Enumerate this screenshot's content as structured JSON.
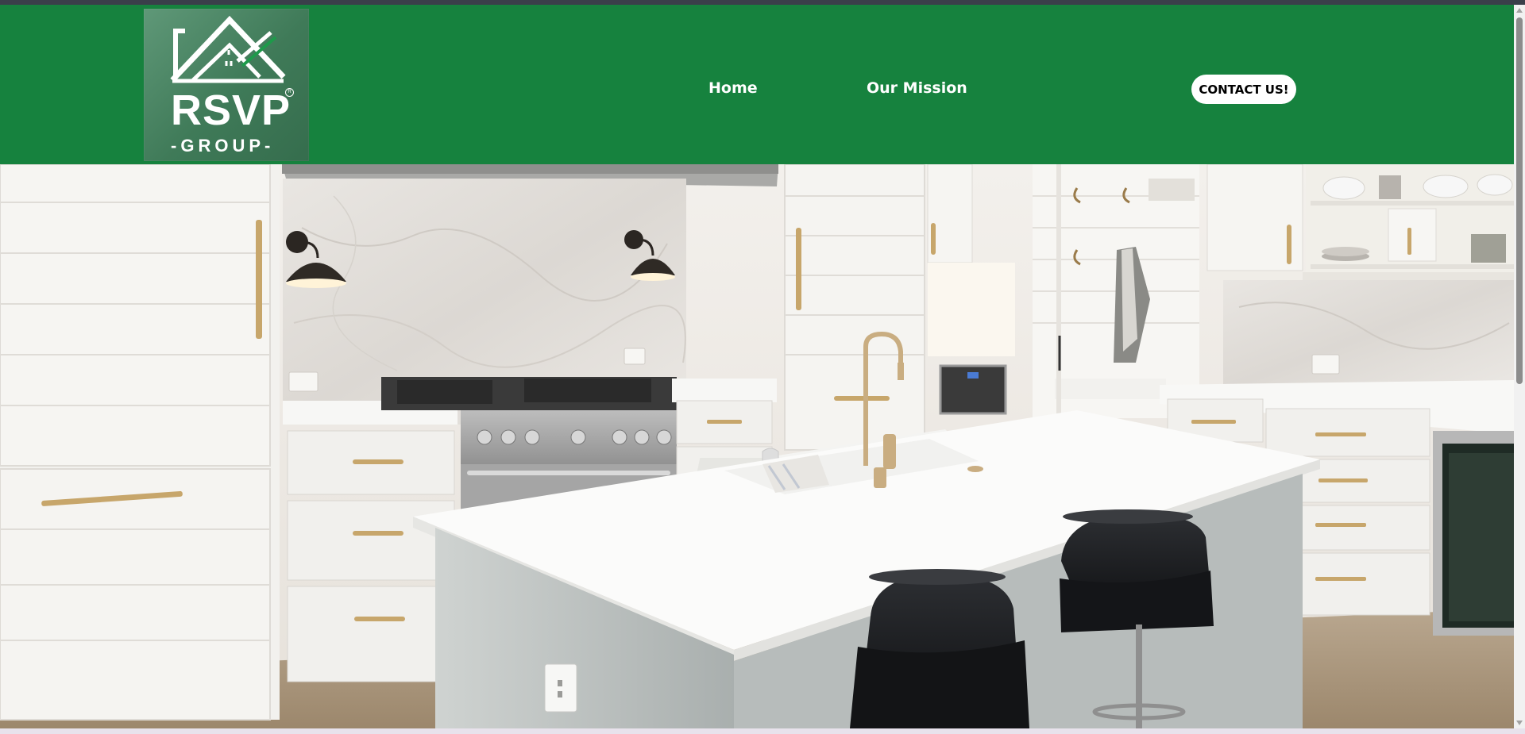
{
  "brand": {
    "logo_main": "RSVP",
    "logo_sub": "-GROUP-",
    "logo_icon": "house-roof-icon"
  },
  "nav": {
    "items": [
      {
        "label": "Home"
      },
      {
        "label": "Our Mission"
      }
    ],
    "contact_label": "CONTACT US!"
  },
  "hero": {
    "image_alt": "White kitchen with island, sink and black bar stools"
  },
  "colors": {
    "nav_green": "#16823e",
    "button_bg": "#ffffff",
    "logo_bg": "#4a8563"
  }
}
